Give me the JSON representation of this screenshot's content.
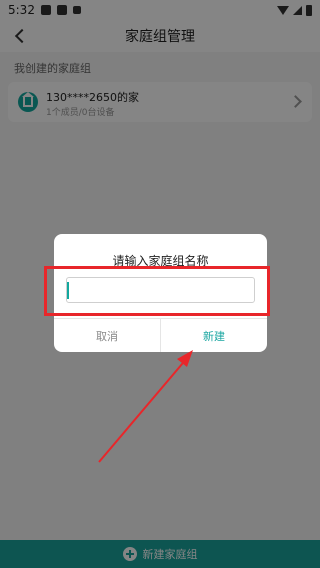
{
  "status_bar": {
    "time": "5:32"
  },
  "header": {
    "title": "家庭组管理"
  },
  "section": {
    "label": "我创建的家庭组"
  },
  "group": {
    "name": "130****2650的家",
    "sub": "1个成员/0台设备"
  },
  "dialog": {
    "title": "请输入家庭组名称",
    "input_value": "",
    "cancel_label": "取消",
    "confirm_label": "新建"
  },
  "bottom": {
    "create_label": "新建家庭组"
  },
  "colors": {
    "accent": "#1aa39b",
    "highlight": "#e8262a"
  },
  "icons": {
    "back": "chevron-left-icon",
    "home": "home-icon",
    "chevron": "chevron-right-icon",
    "plus": "plus-circle-icon"
  }
}
